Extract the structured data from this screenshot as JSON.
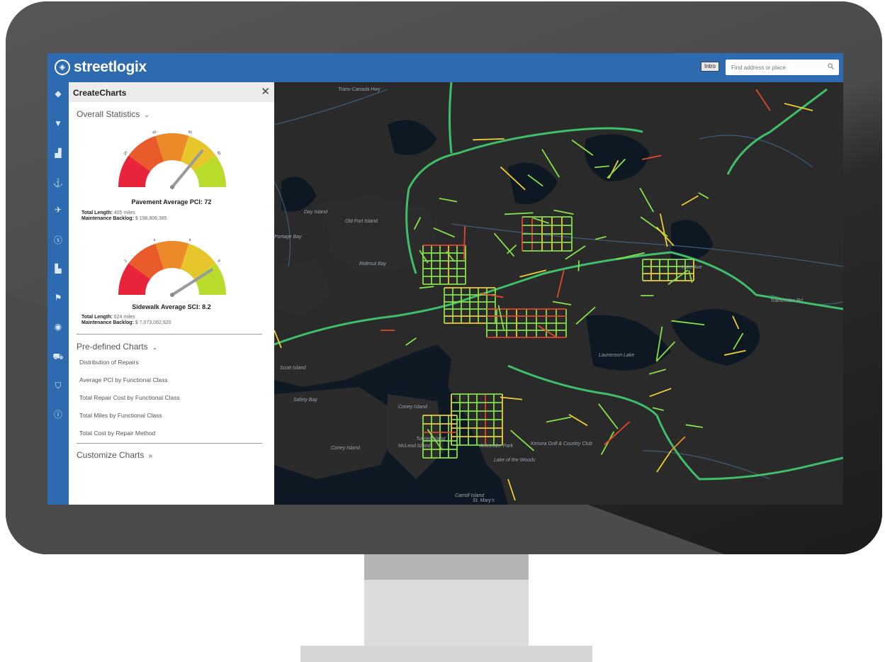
{
  "app": {
    "logo_text": "streetlogix",
    "intro_button": "Intro"
  },
  "search": {
    "placeholder": "Find address or place"
  },
  "nav_icons": [
    "layers-icon",
    "filter-icon",
    "chart-icon",
    "anchor-icon",
    "satellite-icon",
    "dollar-icon",
    "building-icon",
    "flag-icon",
    "eye-icon",
    "vehicle-icon",
    "graduation-icon",
    "info-icon"
  ],
  "panel": {
    "title": "CreateCharts",
    "overall_stats_label": "Overall Statistics",
    "pavement": {
      "title": "Pavement Average PCI: 72",
      "value": 72,
      "ticks": [
        "0",
        "20",
        "40",
        "60",
        "80",
        "100"
      ],
      "total_length_label": "Total Length:",
      "total_length": "405 miles",
      "backlog_label": "Maintenance Backlog:",
      "backlog": "$ 198,806,385"
    },
    "sidewalk": {
      "title": "Sidewalk Average SCI: 8.2",
      "value": 8.2,
      "ticks": [
        "0",
        "2",
        "4",
        "6",
        "8",
        "10"
      ],
      "total_length_label": "Total Length:",
      "total_length": "624 miles",
      "backlog_label": "Maintenance Backlog:",
      "backlog": "$ 7,073,082,920"
    },
    "predefined_label": "Pre-defined Charts",
    "predefined": [
      "Distribution of Repairs",
      "Average PCI by Functional Class",
      "Total Repair Cost by Functional Class",
      "Total Miles by Functional Class",
      "Total Cost by Repair Method"
    ],
    "customize_label": "Customize Charts"
  },
  "map_labels": {
    "trans_canada": "Trans-Canada Hwy",
    "old_fort_island": "Old Fort Island",
    "rideout_bay": "Rideout Bay",
    "safety_bay": "Safety Bay",
    "coney_island": "Coney Island",
    "coney": "Coney Island",
    "mcleod_island": "McLeod Island",
    "tunnel_island": "Tunnel Island",
    "anicinabe_park": "Anicinabe Park",
    "lake_of_the_woods": "Lake of the Woods",
    "kenora_golf": "Kenora Golf & Country Club",
    "laurenson_lake": "Laurenson Lake",
    "st_marys": "St. Mary's",
    "carroll_island": "Carroll Island",
    "day_island": "Day Island",
    "portage_bay": "Portage Bay",
    "scott_island": "Scott Island",
    "transmitter_rd": "Transmitter Rd",
    "lake_ave": "Lake Ave"
  },
  "colors": {
    "topbar": "#2d6ab0",
    "good": "#8be04e",
    "fair": "#f2c431",
    "poor": "#e8432e",
    "map_bg": "#0f1923"
  }
}
